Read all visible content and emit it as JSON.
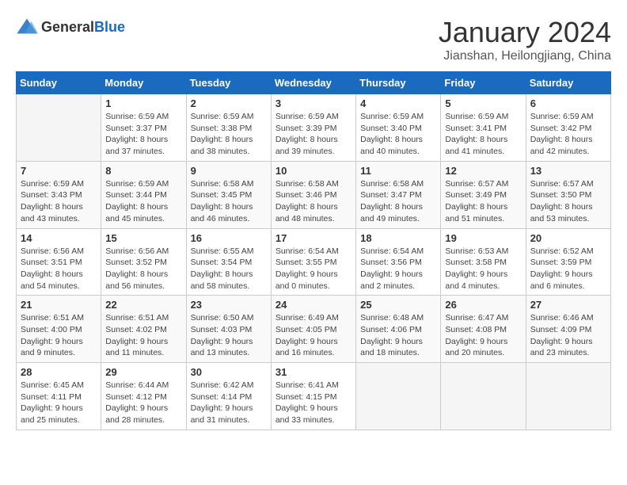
{
  "header": {
    "logo_general": "General",
    "logo_blue": "Blue",
    "title": "January 2024",
    "subtitle": "Jianshan, Heilongjiang, China"
  },
  "days_of_week": [
    "Sunday",
    "Monday",
    "Tuesday",
    "Wednesday",
    "Thursday",
    "Friday",
    "Saturday"
  ],
  "weeks": [
    [
      {
        "day": "",
        "info": ""
      },
      {
        "day": "1",
        "info": "Sunrise: 6:59 AM\nSunset: 3:37 PM\nDaylight: 8 hours\nand 37 minutes."
      },
      {
        "day": "2",
        "info": "Sunrise: 6:59 AM\nSunset: 3:38 PM\nDaylight: 8 hours\nand 38 minutes."
      },
      {
        "day": "3",
        "info": "Sunrise: 6:59 AM\nSunset: 3:39 PM\nDaylight: 8 hours\nand 39 minutes."
      },
      {
        "day": "4",
        "info": "Sunrise: 6:59 AM\nSunset: 3:40 PM\nDaylight: 8 hours\nand 40 minutes."
      },
      {
        "day": "5",
        "info": "Sunrise: 6:59 AM\nSunset: 3:41 PM\nDaylight: 8 hours\nand 41 minutes."
      },
      {
        "day": "6",
        "info": "Sunrise: 6:59 AM\nSunset: 3:42 PM\nDaylight: 8 hours\nand 42 minutes."
      }
    ],
    [
      {
        "day": "7",
        "info": "Sunrise: 6:59 AM\nSunset: 3:43 PM\nDaylight: 8 hours\nand 43 minutes."
      },
      {
        "day": "8",
        "info": "Sunrise: 6:59 AM\nSunset: 3:44 PM\nDaylight: 8 hours\nand 45 minutes."
      },
      {
        "day": "9",
        "info": "Sunrise: 6:58 AM\nSunset: 3:45 PM\nDaylight: 8 hours\nand 46 minutes."
      },
      {
        "day": "10",
        "info": "Sunrise: 6:58 AM\nSunset: 3:46 PM\nDaylight: 8 hours\nand 48 minutes."
      },
      {
        "day": "11",
        "info": "Sunrise: 6:58 AM\nSunset: 3:47 PM\nDaylight: 8 hours\nand 49 minutes."
      },
      {
        "day": "12",
        "info": "Sunrise: 6:57 AM\nSunset: 3:49 PM\nDaylight: 8 hours\nand 51 minutes."
      },
      {
        "day": "13",
        "info": "Sunrise: 6:57 AM\nSunset: 3:50 PM\nDaylight: 8 hours\nand 53 minutes."
      }
    ],
    [
      {
        "day": "14",
        "info": "Sunrise: 6:56 AM\nSunset: 3:51 PM\nDaylight: 8 hours\nand 54 minutes."
      },
      {
        "day": "15",
        "info": "Sunrise: 6:56 AM\nSunset: 3:52 PM\nDaylight: 8 hours\nand 56 minutes."
      },
      {
        "day": "16",
        "info": "Sunrise: 6:55 AM\nSunset: 3:54 PM\nDaylight: 8 hours\nand 58 minutes."
      },
      {
        "day": "17",
        "info": "Sunrise: 6:54 AM\nSunset: 3:55 PM\nDaylight: 9 hours\nand 0 minutes."
      },
      {
        "day": "18",
        "info": "Sunrise: 6:54 AM\nSunset: 3:56 PM\nDaylight: 9 hours\nand 2 minutes."
      },
      {
        "day": "19",
        "info": "Sunrise: 6:53 AM\nSunset: 3:58 PM\nDaylight: 9 hours\nand 4 minutes."
      },
      {
        "day": "20",
        "info": "Sunrise: 6:52 AM\nSunset: 3:59 PM\nDaylight: 9 hours\nand 6 minutes."
      }
    ],
    [
      {
        "day": "21",
        "info": "Sunrise: 6:51 AM\nSunset: 4:00 PM\nDaylight: 9 hours\nand 9 minutes."
      },
      {
        "day": "22",
        "info": "Sunrise: 6:51 AM\nSunset: 4:02 PM\nDaylight: 9 hours\nand 11 minutes."
      },
      {
        "day": "23",
        "info": "Sunrise: 6:50 AM\nSunset: 4:03 PM\nDaylight: 9 hours\nand 13 minutes."
      },
      {
        "day": "24",
        "info": "Sunrise: 6:49 AM\nSunset: 4:05 PM\nDaylight: 9 hours\nand 16 minutes."
      },
      {
        "day": "25",
        "info": "Sunrise: 6:48 AM\nSunset: 4:06 PM\nDaylight: 9 hours\nand 18 minutes."
      },
      {
        "day": "26",
        "info": "Sunrise: 6:47 AM\nSunset: 4:08 PM\nDaylight: 9 hours\nand 20 minutes."
      },
      {
        "day": "27",
        "info": "Sunrise: 6:46 AM\nSunset: 4:09 PM\nDaylight: 9 hours\nand 23 minutes."
      }
    ],
    [
      {
        "day": "28",
        "info": "Sunrise: 6:45 AM\nSunset: 4:11 PM\nDaylight: 9 hours\nand 25 minutes."
      },
      {
        "day": "29",
        "info": "Sunrise: 6:44 AM\nSunset: 4:12 PM\nDaylight: 9 hours\nand 28 minutes."
      },
      {
        "day": "30",
        "info": "Sunrise: 6:42 AM\nSunset: 4:14 PM\nDaylight: 9 hours\nand 31 minutes."
      },
      {
        "day": "31",
        "info": "Sunrise: 6:41 AM\nSunset: 4:15 PM\nDaylight: 9 hours\nand 33 minutes."
      },
      {
        "day": "",
        "info": ""
      },
      {
        "day": "",
        "info": ""
      },
      {
        "day": "",
        "info": ""
      }
    ]
  ]
}
